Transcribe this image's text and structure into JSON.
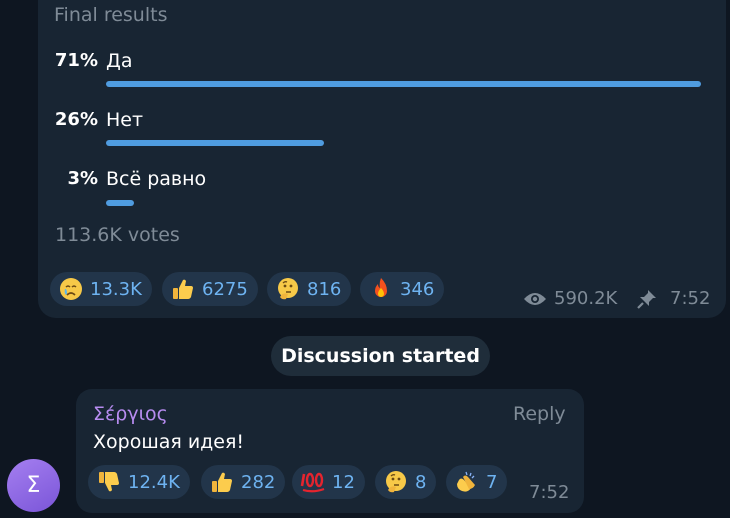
{
  "poll": {
    "status": "Final results",
    "options": [
      {
        "percent": "71%",
        "label": "Да",
        "fraction": 0.71
      },
      {
        "percent": "26%",
        "label": "Нет",
        "fraction": 0.26
      },
      {
        "percent": "3%",
        "label": "Всё равно",
        "fraction": 0.03
      }
    ],
    "votes": "113.6K votes",
    "bar_color": "#4f9ce0",
    "reactions": [
      {
        "emoji": "crying-face",
        "count": "13.3K"
      },
      {
        "emoji": "thumbs-up",
        "count": "6275"
      },
      {
        "emoji": "thinking-face",
        "count": "816"
      },
      {
        "emoji": "fire",
        "count": "346"
      }
    ],
    "views": "590.2K",
    "time": "7:52"
  },
  "service": {
    "label": "Discussion started"
  },
  "comment": {
    "author": "Σέργιος",
    "reply_label": "Reply",
    "text": "Хорошая идея!",
    "avatar_letter": "Σ",
    "author_color": "#b78cf0",
    "reactions": [
      {
        "emoji": "thumbs-down",
        "count": "12.4K"
      },
      {
        "emoji": "thumbs-up",
        "count": "282"
      },
      {
        "emoji": "hundred-points",
        "count": "12"
      },
      {
        "emoji": "thinking-face",
        "count": "8"
      },
      {
        "emoji": "clapping-hands",
        "count": "7"
      }
    ],
    "time": "7:52"
  }
}
